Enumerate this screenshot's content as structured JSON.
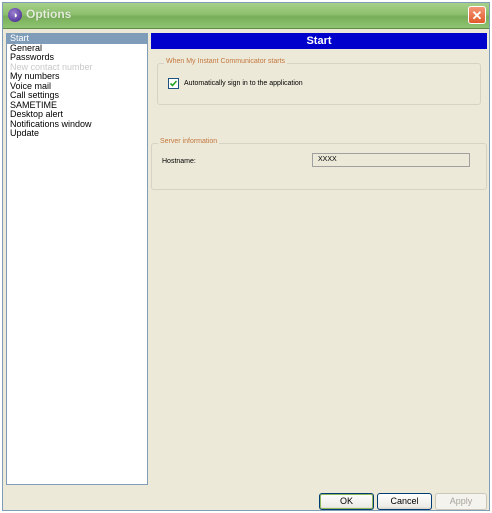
{
  "window": {
    "title": "Options"
  },
  "nav": {
    "items": [
      {
        "label": "Start",
        "selected": true,
        "disabled": false
      },
      {
        "label": "General",
        "selected": false,
        "disabled": false
      },
      {
        "label": "Passwords",
        "selected": false,
        "disabled": false
      },
      {
        "label": "New contact number",
        "selected": false,
        "disabled": true
      },
      {
        "label": "My numbers",
        "selected": false,
        "disabled": false
      },
      {
        "label": "Voice mail",
        "selected": false,
        "disabled": false
      },
      {
        "label": "Call settings",
        "selected": false,
        "disabled": false
      },
      {
        "label": "SAMETIME",
        "selected": false,
        "disabled": false
      },
      {
        "label": "Desktop alert",
        "selected": false,
        "disabled": false
      },
      {
        "label": "Notifications window",
        "selected": false,
        "disabled": false
      },
      {
        "label": "Update",
        "selected": false,
        "disabled": false
      }
    ]
  },
  "content": {
    "header": "Start",
    "startup_group": {
      "label": "When My Instant Communicator starts",
      "auto_signin_label": "Automatically sign in to the application",
      "auto_signin_checked": true
    },
    "server_group": {
      "label": "Server information",
      "hostname_label": "Hostname:",
      "hostname_value": "XXXX"
    }
  },
  "buttons": {
    "ok": "OK",
    "cancel": "Cancel",
    "apply": "Apply"
  }
}
